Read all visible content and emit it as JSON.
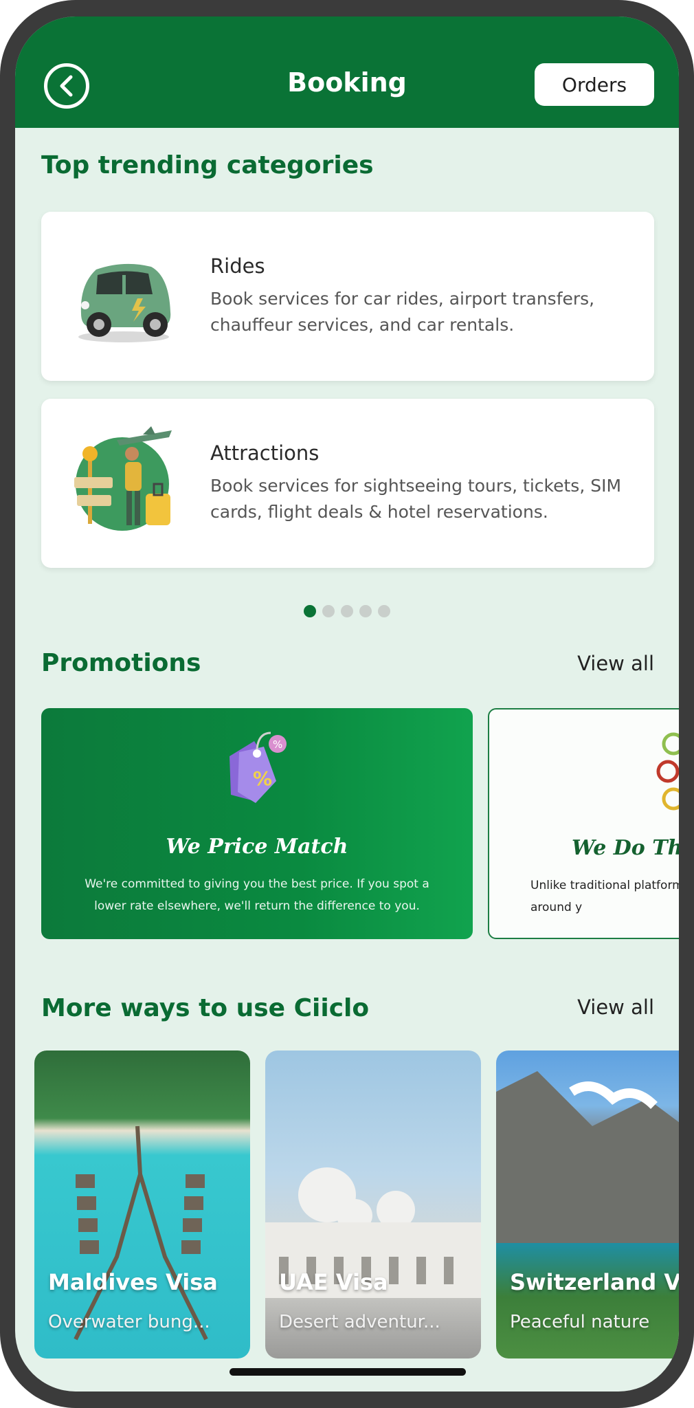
{
  "header": {
    "title": "Booking",
    "orders_label": "Orders"
  },
  "trending": {
    "title": "Top trending categories",
    "cards": [
      {
        "title": "Rides",
        "description": "Book services for car rides, airport transfers, chauffeur services, and car rentals."
      },
      {
        "title": "Attractions",
        "description": "Book services for sightseeing tours, tickets, SIM cards, flight deals & hotel reservations."
      }
    ],
    "page_dots": {
      "count": 5,
      "active_index": 0
    }
  },
  "promotions": {
    "title": "Promotions",
    "view_all": "View all",
    "cards": [
      {
        "title": "We Price Match",
        "text": "We're committed to giving you the best price. If you spot a lower rate elsewhere, we'll return the difference to you."
      },
      {
        "title": "We Do Thi",
        "text": "Unlike traditional platforms built around y"
      }
    ]
  },
  "more_ways": {
    "title": "More ways to use Ciiclo",
    "view_all": "View all",
    "cards": [
      {
        "title": "Maldives Visa",
        "subtitle": "Overwater bung..."
      },
      {
        "title": "UAE Visa",
        "subtitle": "Desert adventur..."
      },
      {
        "title": "Switzerland Vi",
        "subtitle": "Peaceful nature"
      }
    ]
  },
  "colors": {
    "brand_green": "#0a7336",
    "background": "#e4f2ea",
    "card": "#ffffff"
  }
}
